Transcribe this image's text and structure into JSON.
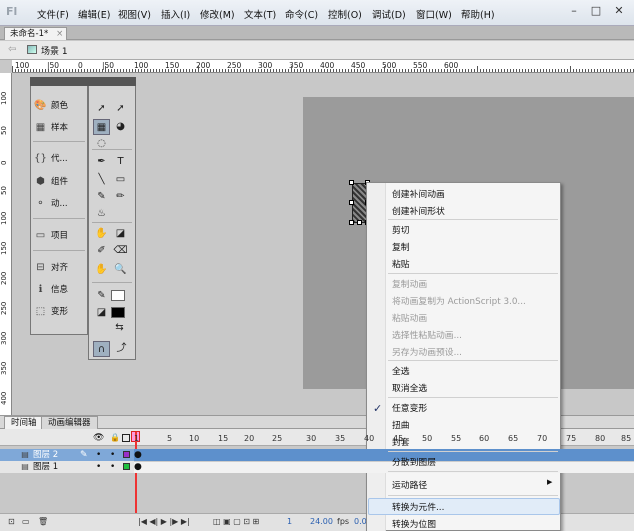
{
  "app": {
    "logo": "Fl"
  },
  "menubar": {
    "items": [
      "文件(F)",
      "编辑(E)",
      "视图(V)",
      "插入(I)",
      "修改(M)",
      "文本(T)",
      "命令(C)",
      "控制(O)",
      "调试(D)",
      "窗口(W)",
      "帮助(H)"
    ],
    "window_controls": [
      "–",
      "□",
      "✕"
    ]
  },
  "document": {
    "tab_title": "未命名-1*",
    "tab_close": "×"
  },
  "scene": {
    "back": "⇦",
    "label": "场景 1"
  },
  "ruler": {
    "h_labels": [
      "100",
      "|50",
      "0",
      "|50",
      "100",
      "150",
      "200",
      "250",
      "300",
      "350",
      "400",
      "450",
      "500",
      "550",
      "600"
    ],
    "v_labels": [
      "100",
      "50",
      "0",
      "50",
      "100",
      "150",
      "200",
      "250",
      "300",
      "350",
      "400"
    ]
  },
  "properties_panel": {
    "items": [
      {
        "label": "颜色",
        "icon": "color-palette-icon",
        "glyph": "🎨"
      },
      {
        "label": "样本",
        "icon": "swatches-icon",
        "glyph": "▦"
      },
      {
        "label": "代...",
        "icon": "code-icon",
        "glyph": "{}"
      },
      {
        "label": "组件",
        "icon": "components-icon",
        "glyph": "⬢"
      },
      {
        "label": "动...",
        "icon": "motion-icon",
        "glyph": "⚬"
      },
      {
        "label": "项目",
        "icon": "project-icon",
        "glyph": "▭"
      },
      {
        "label": "对齐",
        "icon": "align-icon",
        "glyph": "⊟"
      },
      {
        "label": "信息",
        "icon": "info-icon",
        "glyph": "ℹ"
      },
      {
        "label": "变形",
        "icon": "transform-icon",
        "glyph": "⬚"
      }
    ]
  },
  "tools": {
    "glyphs": [
      "➚",
      "➚",
      "▦",
      "◕",
      "◌",
      "",
      "✒",
      "T",
      "╲",
      "▭",
      "✎",
      "✏",
      "♨",
      "",
      "✋",
      "◪",
      "✐",
      "⌫",
      "✋",
      "🔍"
    ],
    "stroke_color": "#ffffff",
    "fill_color": "#000000"
  },
  "timeline": {
    "tabs": [
      "时间轴",
      "动画编辑器"
    ],
    "frame_numbers": [
      "1",
      "5",
      "10",
      "15",
      "20",
      "25",
      "30",
      "35",
      "40",
      "45",
      "50",
      "55",
      "60",
      "65",
      "70",
      "75",
      "80",
      "85"
    ],
    "layers": [
      {
        "name": "图层 2",
        "selected": true,
        "color": "#9b30c8"
      },
      {
        "name": "图层 1",
        "selected": false,
        "color": "#20c040"
      }
    ],
    "footer": {
      "frame": "1",
      "fps": "24.00",
      "fps_unit": "fps",
      "time": "0.0s"
    }
  },
  "context_menu": {
    "groups": [
      [
        {
          "label": "创建补间动画",
          "enabled": true
        },
        {
          "label": "创建补间形状",
          "enabled": true
        }
      ],
      [
        {
          "label": "剪切",
          "enabled": true
        },
        {
          "label": "复制",
          "enabled": true
        },
        {
          "label": "粘贴",
          "enabled": true
        }
      ],
      [
        {
          "label": "复制动画",
          "enabled": false
        },
        {
          "label": "将动画复制为 ActionScript 3.0...",
          "enabled": false
        },
        {
          "label": "粘贴动画",
          "enabled": false
        },
        {
          "label": "选择性粘贴动画...",
          "enabled": false
        },
        {
          "label": "另存为动画预设...",
          "enabled": false
        }
      ],
      [
        {
          "label": "全选",
          "enabled": true
        },
        {
          "label": "取消全选",
          "enabled": true
        }
      ],
      [
        {
          "label": "任意变形",
          "enabled": true,
          "checked": true
        },
        {
          "label": "扭曲",
          "enabled": true
        },
        {
          "label": "封套",
          "enabled": true
        }
      ],
      [
        {
          "label": "分散到图层",
          "enabled": true
        }
      ],
      [
        {
          "label": "运动路径",
          "enabled": true,
          "submenu": true
        }
      ],
      [
        {
          "label": "转换为元件...",
          "enabled": true,
          "highlighted": true
        },
        {
          "label": "转换为位图",
          "enabled": true
        }
      ]
    ],
    "check_glyph": "✓",
    "submenu_glyph": "▶"
  }
}
